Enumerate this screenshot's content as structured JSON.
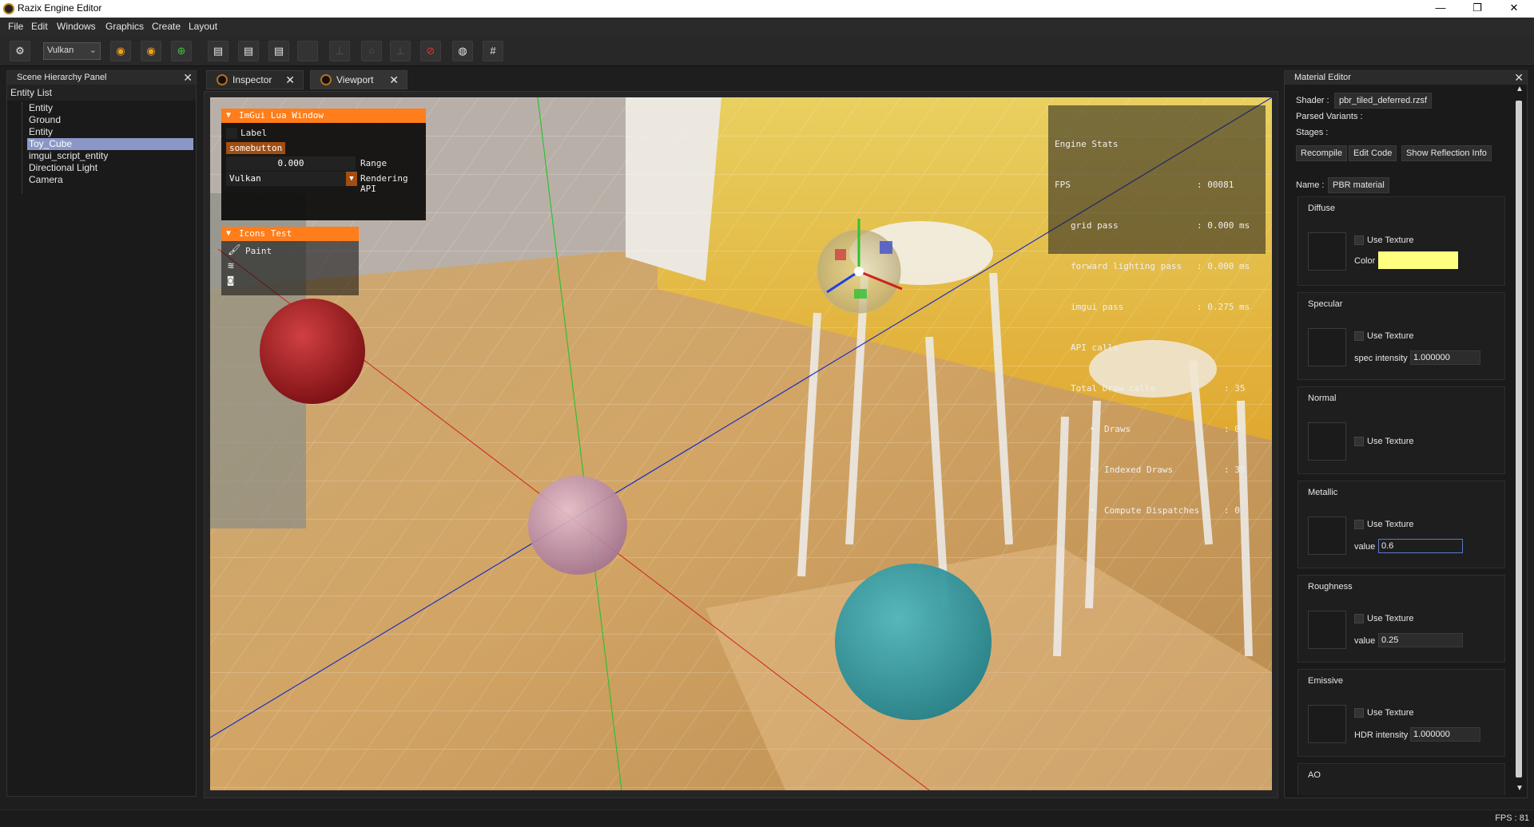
{
  "window": {
    "title": "Razix Engine Editor"
  },
  "menu": [
    "File",
    "Edit",
    "Windows",
    "Graphics",
    "Create",
    "Layout"
  ],
  "toolbar": {
    "api_value": "Vulkan"
  },
  "hierarchy": {
    "title": "Scene Hierarchy Panel",
    "list_label": "Entity List",
    "items": [
      "Entity",
      "Ground",
      "Entity",
      "Toy_Cube",
      "imgui_script_entity",
      "Directional Light",
      "Camera"
    ],
    "selected_index": 3
  },
  "tabs": [
    "Inspector",
    "Viewport"
  ],
  "lua_window": {
    "title": "ImGui Lua Window",
    "label": "Label",
    "button": "somebutton",
    "range_value": "0.000",
    "range_label": "Range",
    "api_value": "Vulkan",
    "api_label": "Rendering API"
  },
  "icons_window": {
    "title": "Icons Test",
    "paint_label": "Paint"
  },
  "engine_stats": {
    "title": "Engine Stats",
    "fps_label": "FPS",
    "fps_value": ": 00081",
    "grid_label": "grid pass",
    "grid_value": ": 0.000 ms",
    "fwd_label": "forward lighting pass",
    "fwd_value": ": 0.000 ms",
    "imgui_label": "imgui pass",
    "imgui_value": ": 0.275 ms",
    "api_calls": "API calls",
    "draw_calls_label": "Total Draw calls",
    "draw_calls_value": ": 35",
    "draws_label": "Draws",
    "draws_value": ": 0",
    "indexed_label": "Indexed Draws",
    "indexed_value": ": 35",
    "compute_label": "Compute Dispatches",
    "compute_value": ": 0"
  },
  "material": {
    "title": "Material Editor",
    "shader_label": "Shader :",
    "shader_value": "pbr_tiled_deferred.rzsf",
    "variants_label": "Parsed Variants :",
    "stages_label": "Stages :",
    "recompile": "Recompile",
    "edit_code": "Edit Code",
    "reflection": "Show Reflection Info",
    "name_label": "Name :",
    "name_value": "PBR material",
    "use_texture": "Use Texture",
    "diffuse": {
      "title": "Diffuse",
      "color_label": "Color",
      "color": "#ffff80"
    },
    "specular": {
      "title": "Specular",
      "label": "spec intensity",
      "value": "1.000000"
    },
    "normal": {
      "title": "Normal"
    },
    "metallic": {
      "title": "Metallic",
      "label": "value",
      "value": "0.6"
    },
    "roughness": {
      "title": "Roughness",
      "label": "value",
      "value": "0.25"
    },
    "emissive": {
      "title": "Emissive",
      "label": "HDR intensity",
      "value": "1.000000"
    },
    "ao": {
      "title": "AO"
    }
  },
  "status": {
    "fps": "FPS : 81"
  },
  "colors": {
    "accent": "#ff7d1a",
    "selection": "#8b97c6"
  }
}
